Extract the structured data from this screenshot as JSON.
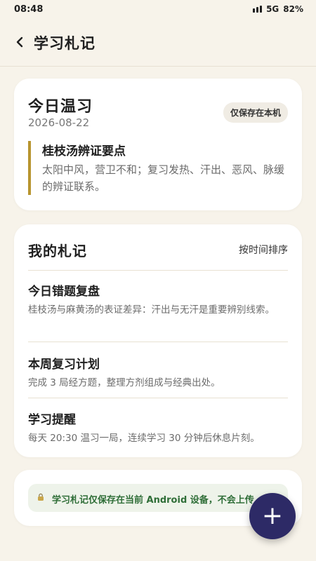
{
  "status": {
    "time": "08:48",
    "network": "5G",
    "battery": "82%"
  },
  "header": {
    "back_icon": "chevron-left-icon",
    "title": "学习札记"
  },
  "review": {
    "heading": "今日温习",
    "date": "2026-08-22",
    "badge": "仅保存在本机",
    "quote_title": "桂枝汤辨证要点",
    "quote_body": "太阳中风，营卫不和；复习发热、汗出、恶风、脉缓的辨证联系。"
  },
  "notes": {
    "heading": "我的札记",
    "sort_label": "按时间排序",
    "items": [
      {
        "title": "今日错题复盘",
        "body": "桂枝汤与麻黄汤的表证差异：汗出与无汗是重要辨别线索。"
      },
      {
        "title": "本周复习计划",
        "body": "完成 3 局经方题，整理方剂组成与经典出处。"
      },
      {
        "title": "学习提醒",
        "body": "每天 20:30 温习一局，连续学习 30 分钟后休息片刻。"
      }
    ]
  },
  "storage_notice": {
    "icon": "lock-icon",
    "text": "学习札记仅保存在当前 Android 设备，不会上传"
  },
  "fab": {
    "label": "+"
  },
  "colors": {
    "background": "#f7f3ea",
    "accent": "#b8952f",
    "fab": "#2d2a66",
    "notice_text": "#2f6e38"
  }
}
